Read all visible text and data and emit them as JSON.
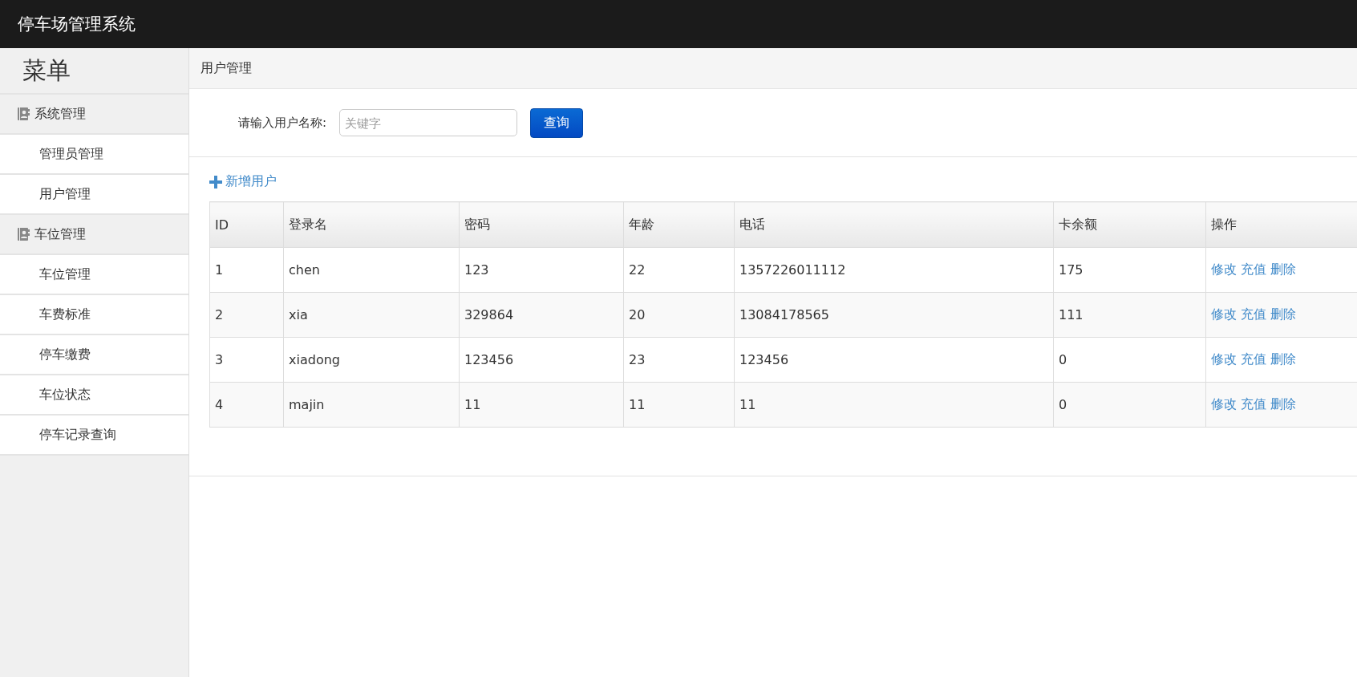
{
  "header": {
    "title": "停车场管理系统"
  },
  "sidebar": {
    "title": "菜单",
    "groups": [
      {
        "label": "系统管理",
        "children": [
          {
            "label": "管理员管理"
          },
          {
            "label": "用户管理"
          }
        ]
      },
      {
        "label": "车位管理",
        "children": [
          {
            "label": "车位管理"
          },
          {
            "label": "车费标准"
          },
          {
            "label": "停车缴费"
          },
          {
            "label": "车位状态"
          },
          {
            "label": "停车记录查询"
          }
        ]
      }
    ]
  },
  "breadcrumb": "用户管理",
  "search": {
    "label": "请输入用户名称:",
    "placeholder": "关键字",
    "button": "查询"
  },
  "add_link": "新增用户",
  "table": {
    "columns": [
      "ID",
      "登录名",
      "密码",
      "年龄",
      "电话",
      "卡余额",
      "操作"
    ],
    "rows": [
      {
        "cells": [
          "1",
          "chen",
          "123",
          "22",
          "1357226011112",
          "175"
        ],
        "actions": [
          "修改",
          "充值",
          "删除"
        ]
      },
      {
        "cells": [
          "2",
          "xia",
          "329864",
          "20",
          "13084178565",
          "111"
        ],
        "actions": [
          "修改",
          "充值",
          "删除"
        ]
      },
      {
        "cells": [
          "3",
          "xiadong",
          "123456",
          "23",
          "123456",
          "0"
        ],
        "actions": [
          "修改",
          "充值",
          "删除"
        ]
      },
      {
        "cells": [
          "4",
          "majin",
          "11",
          "11",
          "11",
          "0"
        ],
        "actions": [
          "修改",
          "充值",
          "删除"
        ]
      }
    ]
  }
}
